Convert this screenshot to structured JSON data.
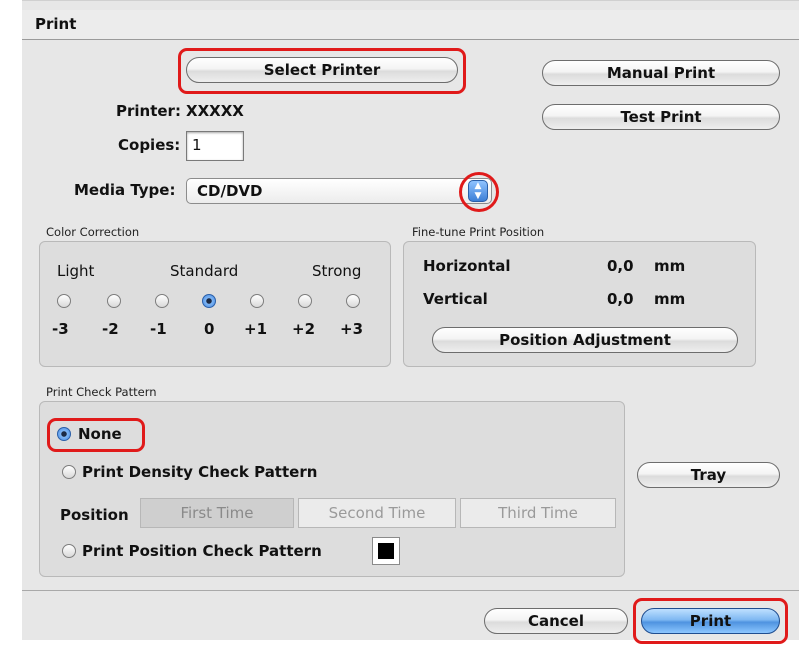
{
  "dialog": {
    "title": "Print",
    "select_printer_button": "Select Printer",
    "manual_print_button": "Manual Print",
    "test_print_button": "Test Print",
    "printer_label": "Printer:",
    "printer_value": "XXXXX",
    "copies_label": "Copies:",
    "copies_value": "1",
    "media_type_label": "Media Type:",
    "media_type_value": "CD/DVD"
  },
  "color_correction": {
    "title": "Color Correction",
    "light_label": "Light",
    "standard_label": "Standard",
    "strong_label": "Strong",
    "levels": [
      "-3",
      "-2",
      "-1",
      "0",
      "+1",
      "+2",
      "+3"
    ],
    "selected_level": "0"
  },
  "fine_tune": {
    "title": "Fine-tune Print Position",
    "horizontal_label": "Horizontal",
    "horizontal_value": "0,0",
    "horizontal_unit": "mm",
    "vertical_label": "Vertical",
    "vertical_value": "0,0",
    "vertical_unit": "mm",
    "position_adjustment_button": "Position Adjustment"
  },
  "check_pattern": {
    "title": "Print Check Pattern",
    "options": [
      "None",
      "Print Density Check Pattern",
      "Print Position Check Pattern"
    ],
    "selected": "None",
    "position_label": "Position",
    "position_segments": [
      "First Time",
      "Second Time",
      "Third Time"
    ],
    "selected_segment": "First Time"
  },
  "tray_button": "Tray",
  "footer": {
    "cancel_button": "Cancel",
    "print_button": "Print"
  },
  "colors": {
    "highlight": "#e01a1a",
    "default_button": "#4f93e0",
    "window_bg": "#e7e7e7"
  }
}
